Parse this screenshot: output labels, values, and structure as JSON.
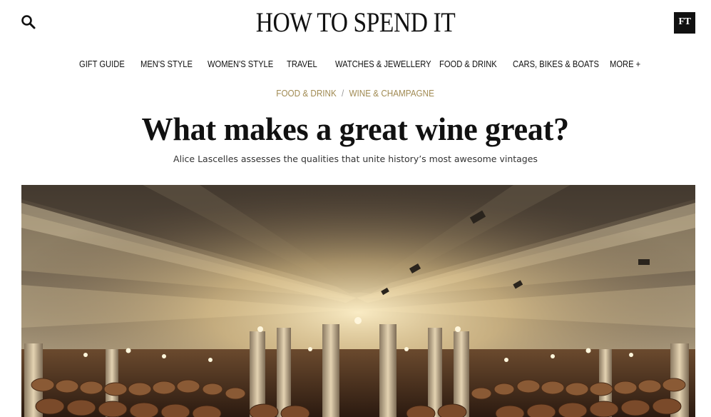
{
  "header": {
    "logo_text": "HOW TO SPEND IT",
    "ft_badge": "FT",
    "search_icon": "search-icon"
  },
  "nav": {
    "items": [
      {
        "label": "GIFT GUIDE"
      },
      {
        "label": "MEN'S STYLE"
      },
      {
        "label": "WOMEN'S STYLE"
      },
      {
        "label": "TRAVEL"
      },
      {
        "label": "WATCHES & JEWELLERY"
      },
      {
        "label": "FOOD & DRINK"
      },
      {
        "label": "CARS, BIKES & BOATS"
      },
      {
        "label": "MORE +"
      }
    ]
  },
  "breadcrumb": {
    "primary": "FOOD & DRINK",
    "separator": "/",
    "secondary": "WINE & CHAMPAGNE"
  },
  "article": {
    "headline": "What makes a great wine great?",
    "standfirst": "Alice Lascelles assesses the qualities that unite history’s most awesome vintages"
  },
  "colors": {
    "text": "#111111",
    "breadcrumb_accent": "#a08a52",
    "ft_badge_bg": "#111111"
  }
}
